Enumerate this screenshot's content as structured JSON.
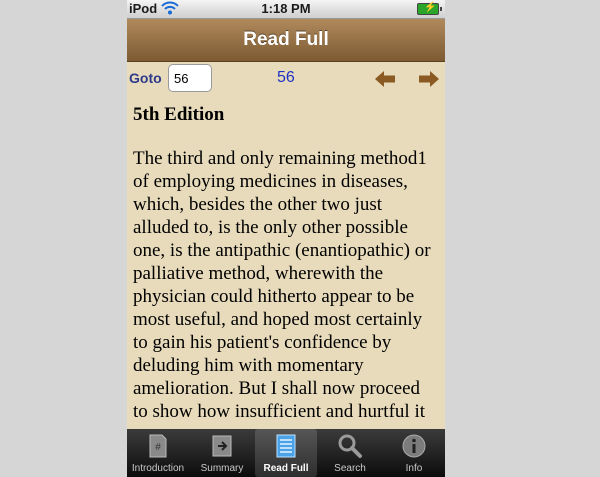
{
  "status_bar": {
    "carrier": "iPod",
    "time": "1:18 PM"
  },
  "nav": {
    "title": "Read Full"
  },
  "goto": {
    "label": "Goto",
    "input_value": "56",
    "page_number": "56"
  },
  "content": {
    "heading": "5th Edition",
    "body": "The third and only remaining method1 of employing medicines in diseases, which, besides the other two just alluded to, is the only other possible one, is the antipathic (enantiopathic) or palliative method, wherewith the physician could hitherto appear to be most useful, and hoped most certainly to gain his patient's confidence by deluding him with momentary amelioration. But I shall now proceed to show how insufficient and hurtful it is"
  },
  "tabs": [
    {
      "label": "Introduction",
      "icon": "introduction-icon",
      "active": false
    },
    {
      "label": "Summary",
      "icon": "summary-icon",
      "active": false
    },
    {
      "label": "Read Full",
      "icon": "read-full-icon",
      "active": true
    },
    {
      "label": "Search",
      "icon": "search-icon",
      "active": false
    },
    {
      "label": "Info",
      "icon": "info-icon",
      "active": false
    }
  ],
  "colors": {
    "nav_brown": "#8f6a3f",
    "page_bg": "#e7dbbb",
    "link_blue": "#1d32c4",
    "arrow_brown": "#8b5a22"
  }
}
